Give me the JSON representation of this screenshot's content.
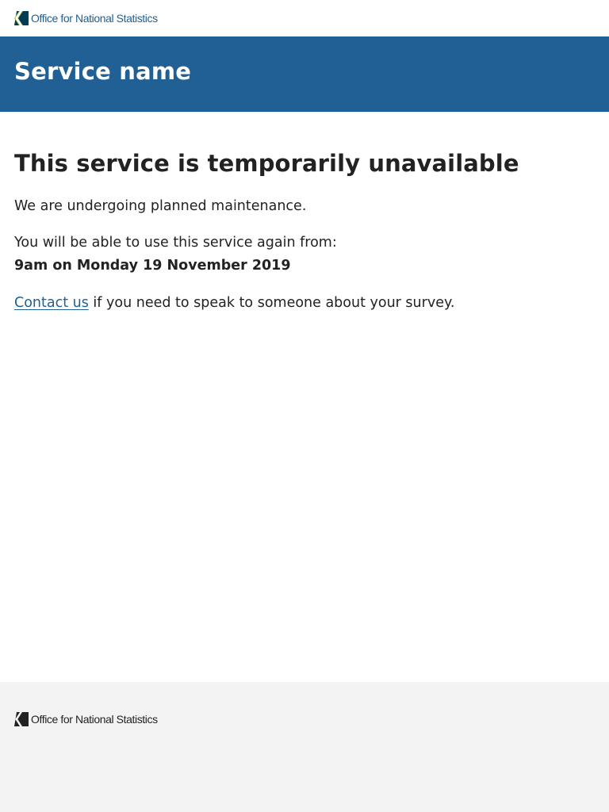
{
  "header": {
    "logo_text_light": "Office for ",
    "logo_text_bold": "National Statistics",
    "logo_color": "#206095",
    "logo_accent": "#003c57"
  },
  "masthead": {
    "service_name": "Service name",
    "background": "#206095"
  },
  "main": {
    "title": "This service is temporarily unavailable",
    "maintenance_text": "We are undergoing planned maintenance.",
    "available_again_text": "You will be able to use this service again from:",
    "available_datetime": "9am on Monday 19 November 2019",
    "contact_link": "Contact us",
    "contact_suffix": " if you need to speak to someone about your survey."
  },
  "footer": {
    "logo_text_light": "Office for ",
    "logo_text_bold": "National Statistics",
    "background": "#f3f3f3"
  }
}
